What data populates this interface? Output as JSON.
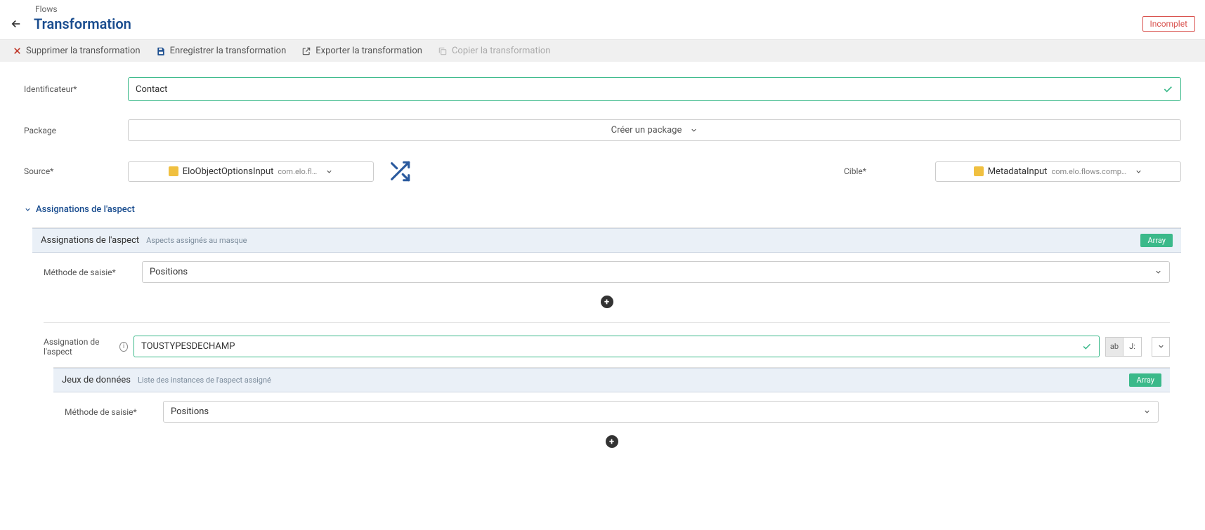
{
  "breadcrumb": "Flows",
  "page_title": "Transformation",
  "status_badge": "Incomplet",
  "toolbar": {
    "delete": "Supprimer la transformation",
    "save": "Enregistrer la transformation",
    "export": "Exporter la transformation",
    "copy": "Copier la transformation"
  },
  "fields": {
    "identifier_label": "Identificateur*",
    "identifier_value": "Contact",
    "package_label": "Package",
    "package_button": "Créer un package",
    "source_label": "Source*",
    "source_name": "EloObjectOptionsInput",
    "source_path": "com.elo.fl…",
    "target_label": "Cible*",
    "target_name": "MetadataInput",
    "target_path": "com.elo.flows.comp…"
  },
  "section": {
    "title": "Assignations de l'aspect",
    "panel1_title": "Assignations de l'aspect",
    "panel1_sub": "Aspects assignés au masque",
    "array_badge": "Array",
    "input_method_label": "Méthode de saisie*",
    "input_method_value": "Positions",
    "aspect_assign_label": "Assignation de l'aspect",
    "aspect_assign_value": "TOUSTYPESDECHAMP",
    "mode_ab": "ab",
    "mode_js": "J:",
    "panel2_title": "Jeux de données",
    "panel2_sub": "Liste des instances de l'aspect assigné",
    "input_method2_value": "Positions"
  }
}
